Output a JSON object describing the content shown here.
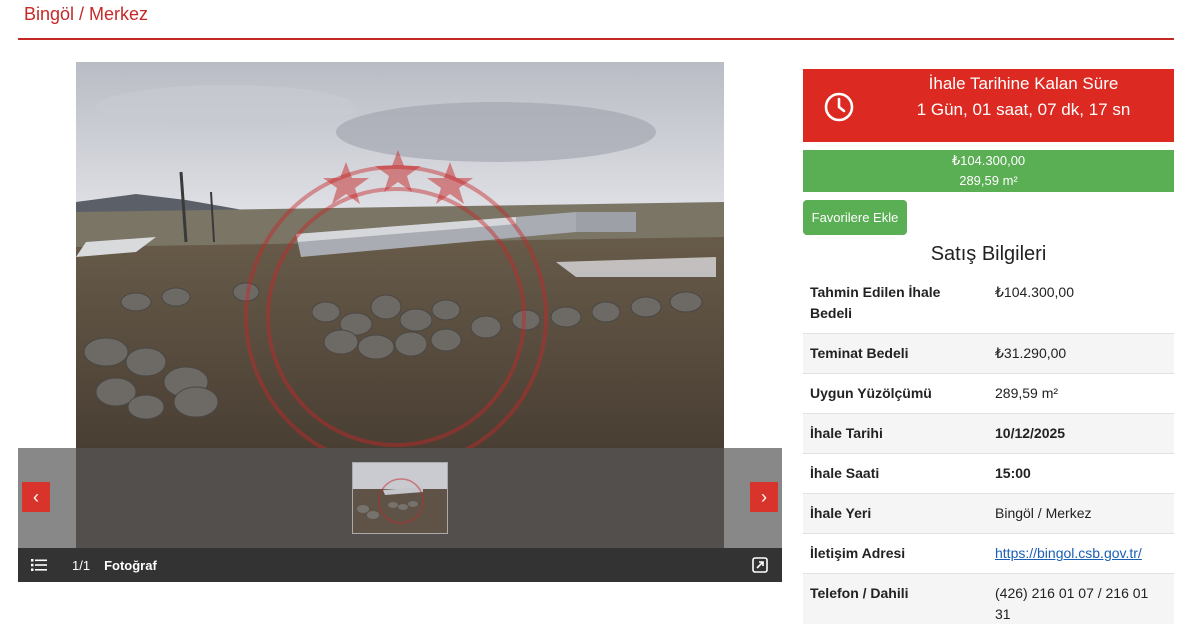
{
  "header": {
    "location": "Bingöl / Merkez"
  },
  "gallery": {
    "counter": "1/1",
    "label": "Fotoğraf",
    "prev_arrow": "‹",
    "next_arrow": "›"
  },
  "countdown": {
    "title": "İhale Tarihine Kalan Süre",
    "value": "1 Gün, 01 saat, 07 dk, 17 sn",
    "color": "#dc2a22"
  },
  "price": {
    "amount": "₺104.300,00",
    "area": "289,59 m²",
    "color": "#5aae53"
  },
  "favorite_button": {
    "label": "Favorilere Ekle"
  },
  "sales_info": {
    "title": "Satış Bilgileri",
    "rows": [
      {
        "label": "Tahmin Edilen İhale Bedeli",
        "value": "₺104.300,00"
      },
      {
        "label": "Teminat Bedeli",
        "value": "₺31.290,00"
      },
      {
        "label": "Uygun Yüzölçümü",
        "value": "289,59 m²"
      },
      {
        "label": "İhale Tarihi",
        "value": "10/12/2025"
      },
      {
        "label": "İhale Saati",
        "value": "15:00"
      },
      {
        "label": "İhale Yeri",
        "value": "Bingöl / Merkez"
      },
      {
        "label": "İletişim Adresi",
        "value": "https://bingol.csb.gov.tr/"
      },
      {
        "label": "Telefon / Dahili",
        "value": "(426) 216 01 07 / 216 01 31"
      }
    ]
  },
  "icons": {
    "clock": "clock-icon",
    "list": "list-icon",
    "expand": "expand-icon"
  }
}
